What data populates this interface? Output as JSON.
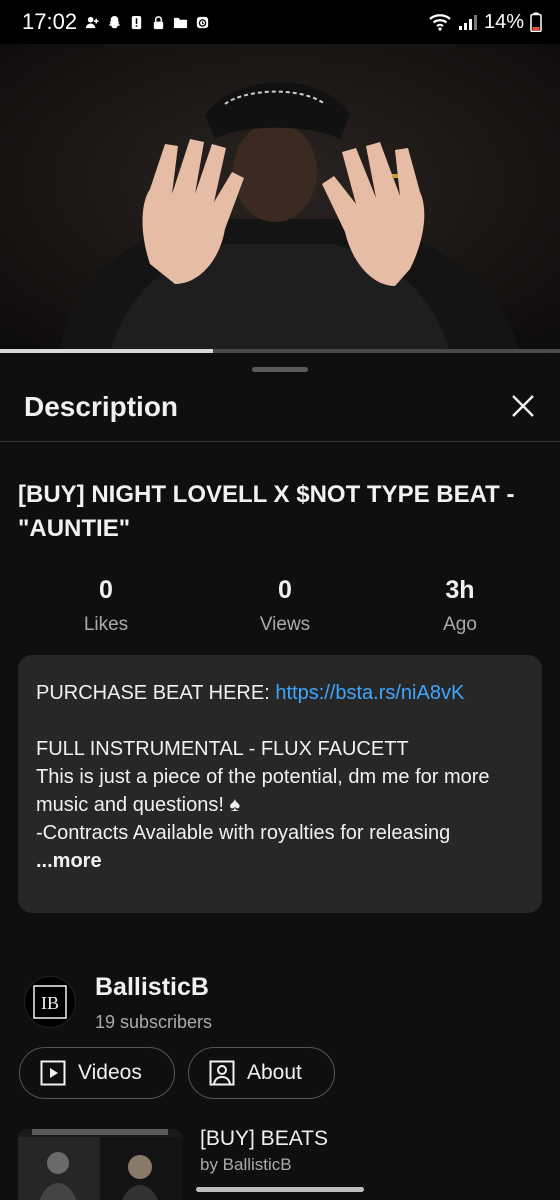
{
  "status_bar": {
    "time": "17:02",
    "battery": "14%"
  },
  "video": {
    "progress_fraction": 0.38
  },
  "description_panel": {
    "title": "Description",
    "video_title": "[BUY] NIGHT LOVELL X $NOT TYPE BEAT -\"AUNTIE\"",
    "stats": [
      {
        "value": "0",
        "label": "Likes"
      },
      {
        "value": "0",
        "label": "Views"
      },
      {
        "value": "3h",
        "label": "Ago"
      }
    ],
    "description": {
      "purchase_label": "PURCHASE BEAT HERE:",
      "purchase_link": "https://bsta.rs/niA8vK",
      "line1": "FULL INSTRUMENTAL - FLUX FAUCETT",
      "line2": "This is just a piece of the potential, dm me for more music and questions! ♠",
      "line3": "-Contracts Available with royalties for releasing",
      "more": "...more"
    }
  },
  "channel": {
    "name": "BallisticB",
    "subscribers": "19 subscribers",
    "avatar_text": "IB"
  },
  "buttons": {
    "videos": "Videos",
    "about": "About"
  },
  "playlist": {
    "title": "[BUY] BEATS",
    "byline": "by BallisticB"
  }
}
